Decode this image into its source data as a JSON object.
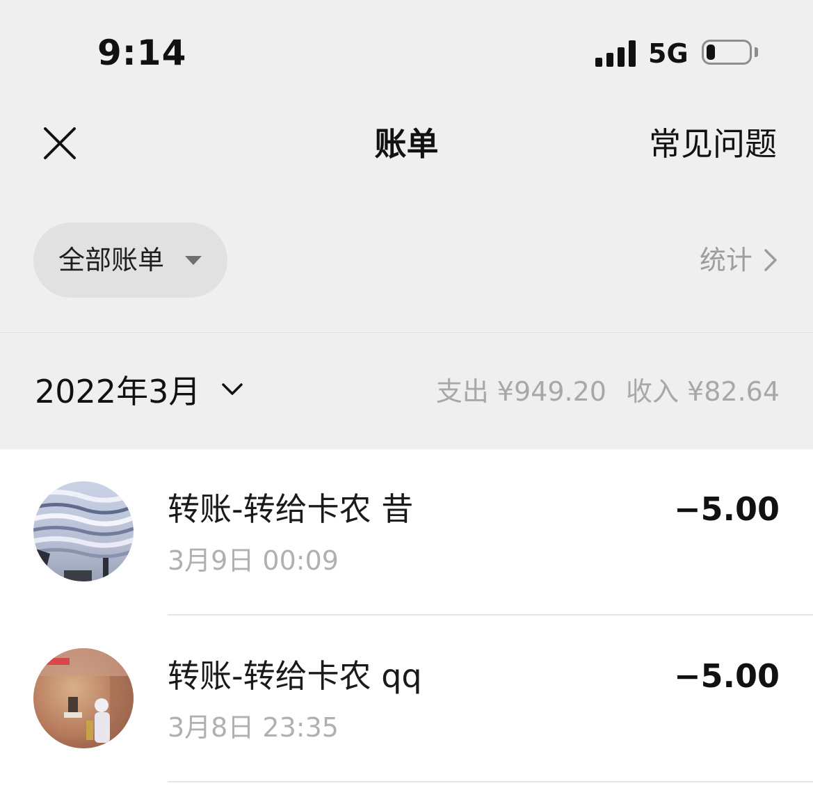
{
  "status_bar": {
    "time": "9:14",
    "network": "5G",
    "battery_level": 0.2
  },
  "nav": {
    "close_icon": "close-icon",
    "title": "账单",
    "faq_label": "常见问题"
  },
  "filter": {
    "label": "全部账单",
    "stats_label": "统计"
  },
  "month": {
    "label": "2022年3月",
    "expense": "支出 ¥949.20",
    "income": "收入 ¥82.64"
  },
  "transactions": [
    {
      "title": "转账-转给卡农 昔",
      "time": "3月9日 00:09",
      "amount": "−5.00"
    },
    {
      "title": "转账-转给卡农 qq",
      "time": "3月8日 23:35",
      "amount": "−5.00"
    }
  ],
  "colors": {
    "background_top": "#efefef",
    "list_background": "#ffffff",
    "text_primary": "#1a1a1a",
    "text_secondary": "#a8a8a8",
    "pill_background": "#e1e1e1"
  }
}
